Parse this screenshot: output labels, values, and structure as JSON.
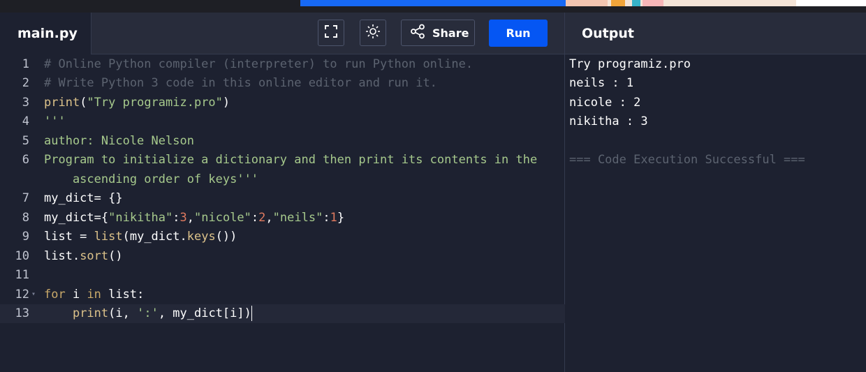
{
  "header": {
    "file_tab": "main.py",
    "share_label": "Share",
    "run_label": "Run",
    "output_title": "Output",
    "icons": {
      "fullscreen": "fullscreen-icon",
      "theme": "sun-icon",
      "share": "share-icon"
    }
  },
  "editor": {
    "lines": [
      {
        "num": "1",
        "parts": [
          {
            "t": "# Online Python compiler (interpreter) to run Python online.",
            "c": "c-comment"
          }
        ]
      },
      {
        "num": "2",
        "parts": [
          {
            "t": "# Write Python 3 code in this online editor and run it.",
            "c": "c-comment"
          }
        ]
      },
      {
        "num": "3",
        "parts": [
          {
            "t": "print",
            "c": "c-fn"
          },
          {
            "t": "(",
            "c": ""
          },
          {
            "t": "\"Try programiz.pro\"",
            "c": "c-str"
          },
          {
            "t": ")",
            "c": ""
          }
        ]
      },
      {
        "num": "4",
        "parts": [
          {
            "t": "'''",
            "c": "c-doc"
          }
        ]
      },
      {
        "num": "5",
        "parts": [
          {
            "t": "author: Nicole Nelson",
            "c": "c-doc"
          }
        ]
      },
      {
        "num": "6",
        "parts": [
          {
            "t": "Program to initialize a dictionary and then print its contents in the",
            "c": "c-doc"
          }
        ]
      },
      {
        "num": "",
        "parts": [
          {
            "t": "    ascending order of keys'''",
            "c": "c-doc"
          }
        ]
      },
      {
        "num": "7",
        "parts": [
          {
            "t": "my_dict= {}",
            "c": ""
          }
        ]
      },
      {
        "num": "8",
        "parts": [
          {
            "t": "my_dict=",
            "c": ""
          },
          {
            "t": "{",
            "c": ""
          },
          {
            "t": "\"nikitha\"",
            "c": "c-str"
          },
          {
            "t": ":",
            "c": ""
          },
          {
            "t": "3",
            "c": "c-num"
          },
          {
            "t": ",",
            "c": ""
          },
          {
            "t": "\"nicole\"",
            "c": "c-str"
          },
          {
            "t": ":",
            "c": ""
          },
          {
            "t": "2",
            "c": "c-num"
          },
          {
            "t": ",",
            "c": ""
          },
          {
            "t": "\"neils\"",
            "c": "c-str"
          },
          {
            "t": ":",
            "c": ""
          },
          {
            "t": "1",
            "c": "c-num"
          },
          {
            "t": "}",
            "c": ""
          }
        ]
      },
      {
        "num": "9",
        "parts": [
          {
            "t": "list = ",
            "c": ""
          },
          {
            "t": "list",
            "c": "c-fn"
          },
          {
            "t": "(my_dict.",
            "c": ""
          },
          {
            "t": "keys",
            "c": "c-fn"
          },
          {
            "t": "())",
            "c": ""
          }
        ]
      },
      {
        "num": "10",
        "parts": [
          {
            "t": "list.",
            "c": ""
          },
          {
            "t": "sort",
            "c": "c-fn"
          },
          {
            "t": "()",
            "c": ""
          }
        ]
      },
      {
        "num": "11",
        "parts": [
          {
            "t": "",
            "c": ""
          }
        ]
      },
      {
        "num": "12",
        "fold": "▾",
        "parts": [
          {
            "t": "for",
            "c": "c-kw"
          },
          {
            "t": " i ",
            "c": ""
          },
          {
            "t": "in",
            "c": "c-kw"
          },
          {
            "t": " list:",
            "c": ""
          }
        ]
      },
      {
        "num": "13",
        "active": true,
        "parts": [
          {
            "t": "    ",
            "c": ""
          },
          {
            "t": "print",
            "c": "c-fn"
          },
          {
            "t": "(i, ",
            "c": ""
          },
          {
            "t": "':'",
            "c": "c-str"
          },
          {
            "t": ", my_dict[i])",
            "c": ""
          }
        ]
      }
    ]
  },
  "output": {
    "lines": [
      {
        "text": "Try programiz.pro",
        "kind": "normal"
      },
      {
        "text": "neils : 1",
        "kind": "normal"
      },
      {
        "text": "nicole : 2",
        "kind": "normal"
      },
      {
        "text": "nikitha : 3",
        "kind": "normal"
      },
      {
        "text": "",
        "kind": "normal"
      },
      {
        "text": "=== Code Execution Successful ===",
        "kind": "success"
      }
    ]
  }
}
